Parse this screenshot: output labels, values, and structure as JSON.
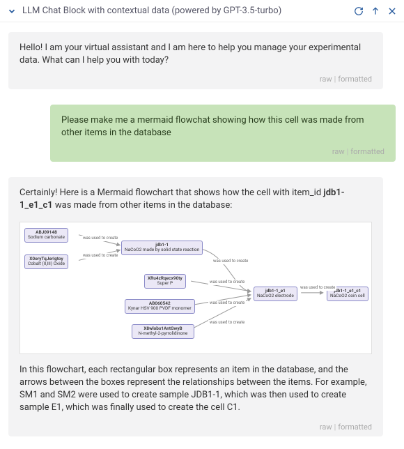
{
  "header": {
    "title": "LLM Chat Block with contextual data (powered by GPT-3.5-turbo)"
  },
  "meta": {
    "raw_label": "raw",
    "formatted_label": "formatted"
  },
  "messages": {
    "m0_text": "Hello! I am your virtual assistant and I am here to help you manage your experimental data. What can I help you with today?",
    "m1_text": "Please make me a mermaid flowchat showing how this cell was made from other items in the database",
    "m2_intro_a": "Certainly! Here is a Mermaid flowchart that shows how the cell with item_id ",
    "m2_intro_b": "jdb1-1_e1_c1",
    "m2_intro_c": " was made from other items in the database:",
    "m2_explain": "In this flowchart, each rectangular box represents an item in the database, and the arrows between the boxes represent the relationships between the items. For example, SM1 and SM2 were used to create sample JDB1-1, which was then used to create sample E1, which was finally used to create the cell C1."
  },
  "edge_label": "was used to create",
  "nodes": {
    "n_sodium_top": "ABJ09148",
    "n_sodium_bot": "Sodium carbonate",
    "n_cobalt_top": "X0oryTqJerIgtoy",
    "n_cobalt_bot": "Cobalt (II,III) Oxide",
    "n_jdb_top": "jdb1-1",
    "n_jdb_bot": "NaCoO2 made by solid state reaction",
    "n_super_top": "XRu4zRqecx90ty",
    "n_super_bot": "Super P",
    "n_pvdf_top": "AB060542",
    "n_pvdf_bot": "Kynar HSV 900 PVDF monomer",
    "n_nmp_top": "X8wlobs1AntGwyB",
    "n_nmp_bot": "N-methyl-2-pyrrolidinone",
    "n_e1_top": "jdb1-1_e1",
    "n_e1_bot": "NaCoO2 electrode",
    "n_c1_top": "jdb1-1_e1_c1",
    "n_c1_bot": "NaCoO2 coin cell"
  }
}
